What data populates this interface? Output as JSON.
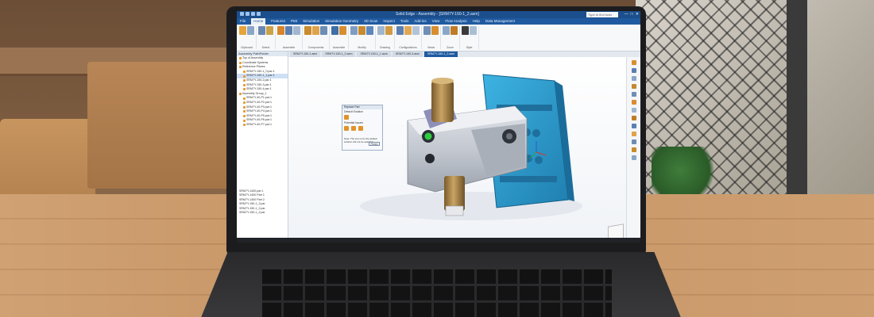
{
  "app": {
    "title": "Solid Edge - Assembly - [SRM7Y-150-1_2.asm]",
    "search_placeholder": "Type to find tools",
    "window_controls": [
      "—",
      "□",
      "✕"
    ]
  },
  "menu": [
    "File",
    "Home",
    "Features",
    "PMI",
    "Simulation",
    "Simulation Geometry",
    "3D Scan",
    "Inspect",
    "Tools",
    "Add-ins",
    "View",
    "Flow Analysis",
    "Help",
    "Data Management"
  ],
  "menu_active_index": 1,
  "ribbon_groups": [
    {
      "label": "Clipboard",
      "colors": [
        "#e5a33a",
        "#8aa7c8"
      ]
    },
    {
      "label": "Select",
      "colors": [
        "#6a87b0",
        "#c9a24a"
      ]
    },
    {
      "label": "Assemble",
      "colors": [
        "#d7852b",
        "#5c7fb0",
        "#a0b7cf"
      ]
    },
    {
      "label": "Components",
      "colors": [
        "#c98b2c",
        "#e0a24b",
        "#6d8db5"
      ]
    },
    {
      "label": "Assemble",
      "colors": [
        "#3e6fa8",
        "#d78e30"
      ]
    },
    {
      "label": "Modify",
      "colors": [
        "#7f9dc2",
        "#c78a30",
        "#5d87bd"
      ]
    },
    {
      "label": "Drawing",
      "colors": [
        "#9fb6cf",
        "#d19a42"
      ]
    },
    {
      "label": "Configurations",
      "colors": [
        "#5c7fb0",
        "#e1a853",
        "#b3c3d6"
      ]
    },
    {
      "label": "Views",
      "colors": [
        "#6f8fb7",
        "#d88d2f"
      ]
    },
    {
      "label": "Zoom",
      "colors": [
        "#8aa7c8",
        "#c07b26"
      ]
    },
    {
      "label": "Style",
      "colors": [
        "#3a3a3a",
        "#a9bed4"
      ]
    }
  ],
  "pathfinder": {
    "header": "Assembly PathFinder",
    "rows": [
      "Top of Assembly",
      "Coordinate Systems",
      "Reference Planes",
      "SRM7Y-150-1_0.par:1",
      "SRM7Y-150-1_1.par:1",
      "SRM7Y-150-2.par:1",
      "SRM7Y-150-3.par:1",
      "SRM7Y-150-4.par:1",
      "Assembly Group_1",
      "SRM7Y-40-P1.par:1",
      "SRM7Y-40-P2.par:1",
      "SRM7Y-40-P3.par:1",
      "SRM7Y-40-P4.par:1",
      "SRM7Y-40-P5.par:1",
      "SRM7Y-40-P6.par:1",
      "SRM7Y-40-P7.par:1"
    ],
    "selected_index": 4,
    "lower_rows": [
      "SRM7Y-1400.par:1",
      "SRM7Y-1400 Part 1",
      "SRM7Y-1400 Part 2",
      "SRM7Y-150-1_2.par",
      "SRM7Y-150-1_2.par",
      "SRM7Y-150-1_2.par"
    ]
  },
  "doc_tabs": [
    "SRM7Y-150-1.asm",
    "SRM7Y-150-1_0.asm",
    "SRM7Y-150-1_1.asm",
    "SRM7Y-150-3.asm",
    "SRM7Y-150-1_2.asm"
  ],
  "doc_tab_active": 4,
  "dialog": {
    "title": "Replace Part",
    "line1": "Default Solution",
    "line2": "Potential Issues",
    "note": "Note: The icon is for the default solution will not be available.",
    "button": "Finish"
  },
  "colors": {
    "titlebar": "#1b4e8c",
    "accent": "#1f5aa0",
    "plate": "#2f9fd2",
    "body_metal": "#c7ccd4",
    "brass": "#b08a4c"
  }
}
